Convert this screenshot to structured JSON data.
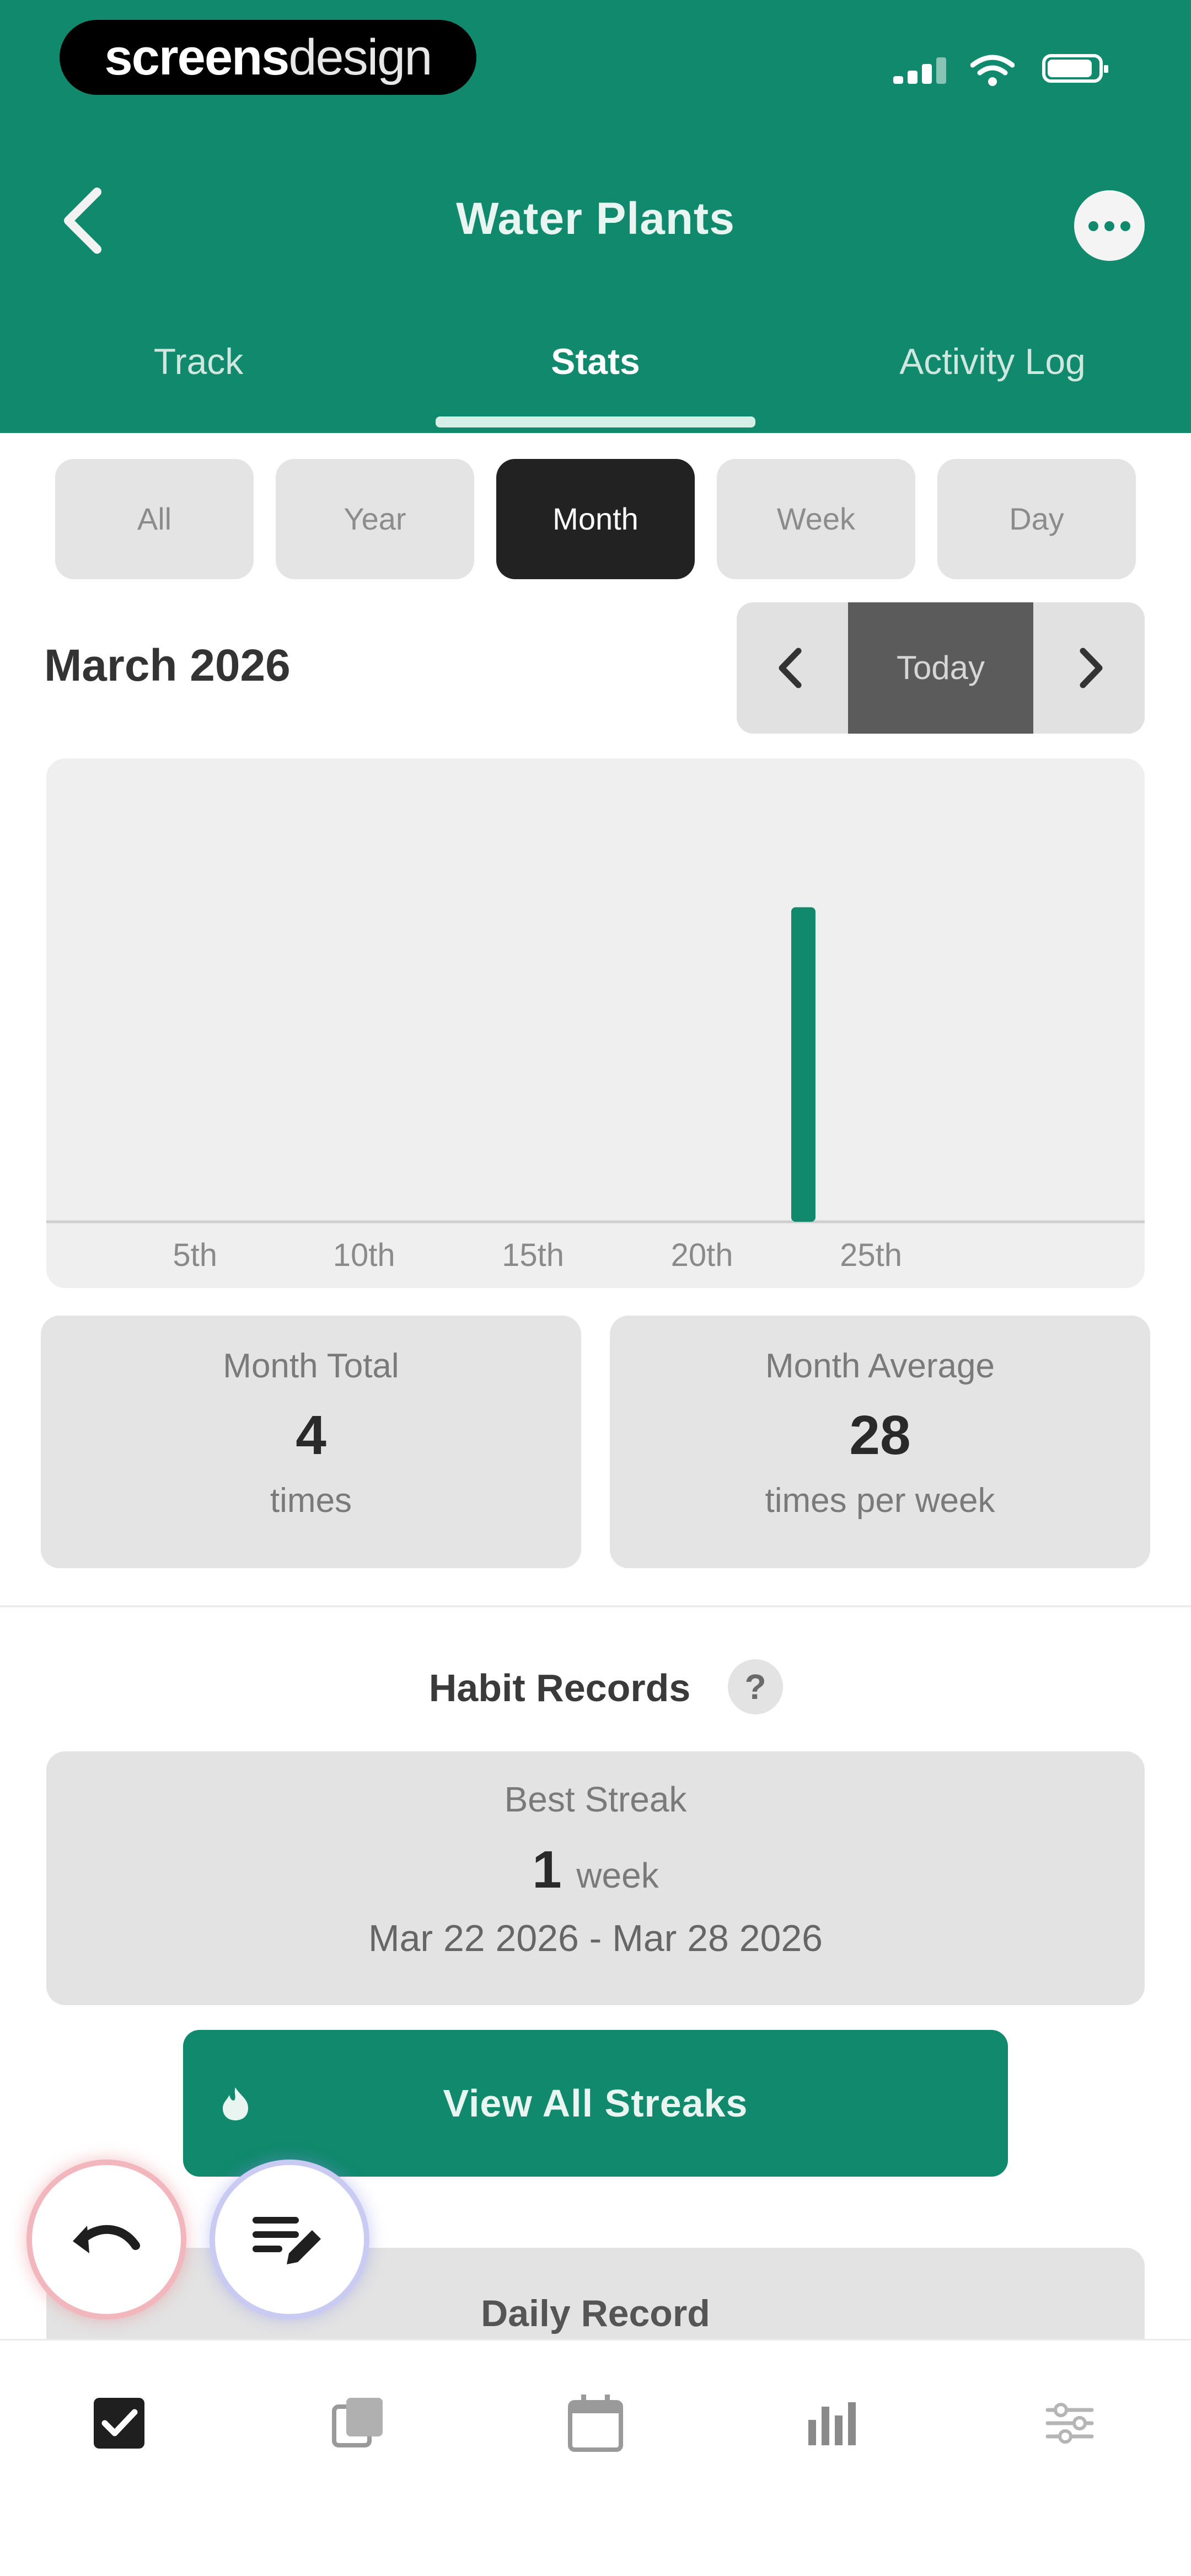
{
  "status_bar": {
    "brand_bold": "screens",
    "brand_light": "design"
  },
  "header": {
    "title": "Water Plants",
    "tabs": [
      {
        "label": "Track",
        "active": false
      },
      {
        "label": "Stats",
        "active": true
      },
      {
        "label": "Activity Log",
        "active": false
      }
    ]
  },
  "periods": [
    {
      "label": "All",
      "active": false
    },
    {
      "label": "Year",
      "active": false
    },
    {
      "label": "Month",
      "active": true
    },
    {
      "label": "Week",
      "active": false
    },
    {
      "label": "Day",
      "active": false
    }
  ],
  "month_label": "March 2026",
  "nav": {
    "today_label": "Today"
  },
  "chart_data": {
    "type": "bar",
    "categories": [
      "5th",
      "10th",
      "15th",
      "20th",
      "25th"
    ],
    "x_tick_labels": [
      "5th",
      "10th",
      "15th",
      "20th",
      "25th"
    ],
    "days_in_month": 31,
    "values": [
      {
        "day": 23,
        "value": 4
      }
    ],
    "ylim": [
      0,
      4.7
    ],
    "grid": false,
    "bar_color": "#10896c"
  },
  "stats": {
    "total": {
      "label": "Month Total",
      "value": "4",
      "unit": "times"
    },
    "average": {
      "label": "Month Average",
      "value": "28",
      "unit": "times per week"
    }
  },
  "records": {
    "title": "Habit Records",
    "help": "?",
    "best_streak": {
      "label": "Best Streak",
      "value": "1",
      "unit": "week",
      "range": "Mar 22 2026 - Mar 28 2026"
    },
    "view_all_label": "View All Streaks",
    "daily_record_label": "Daily Record"
  },
  "colors": {
    "primary": "#10896c",
    "dark": "#222222"
  },
  "icons": {
    "back": "chevron-left-icon",
    "more": "more-dots-icon",
    "undo": "undo-icon",
    "edit": "edit-list-icon",
    "streak": "flame-icon",
    "bottom_nav": [
      "checkbox-icon",
      "copy-icon",
      "calendar-icon",
      "stats-icon",
      "settings-icon"
    ]
  }
}
